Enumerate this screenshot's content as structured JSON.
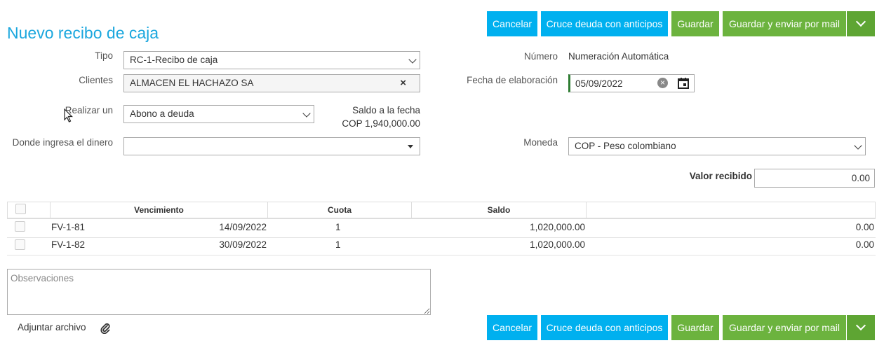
{
  "page_title": "Nuevo recibo de caja",
  "actions": {
    "cancel": "Cancelar",
    "cross": "Cruce deuda con anticipos",
    "save": "Guardar",
    "save_mail": "Guardar y enviar por mail"
  },
  "form": {
    "tipo_label": "Tipo",
    "tipo_value": "RC-1-Recibo de caja",
    "clientes_label": "Clientes",
    "clientes_value": "ALMACEN EL HACHAZO SA",
    "realizar_label": "Realizar un",
    "realizar_value": "Abono a deuda",
    "saldo_label": "Saldo a la fecha",
    "saldo_value": "COP 1,940,000.00",
    "donde_label": "Donde ingresa el dinero",
    "donde_value": "",
    "numero_label": "Número",
    "numero_value": "Numeración Automática",
    "fecha_label": "Fecha de elaboración",
    "fecha_value": "05/09/2022",
    "moneda_label": "Moneda",
    "moneda_value": "COP - Peso colombiano",
    "valor_label": "Valor recibido",
    "valor_value": "0.00"
  },
  "table": {
    "headers": [
      "Vencimiento",
      "Cuota",
      "Saldo"
    ],
    "rows": [
      {
        "doc": "FV-1-81",
        "vencimiento": "14/09/2022",
        "cuota": "1",
        "saldo": "1,020,000.00",
        "valor": "0.00"
      },
      {
        "doc": "FV-1-82",
        "vencimiento": "30/09/2022",
        "cuota": "1",
        "saldo": "1,020,000.00",
        "valor": "0.00"
      }
    ]
  },
  "observaciones_placeholder": "Observaciones",
  "attach_label": "Adjuntar archivo",
  "colors": {
    "blue": "#00b0ef",
    "green": "#6cb33e",
    "title": "#1ba7de"
  }
}
